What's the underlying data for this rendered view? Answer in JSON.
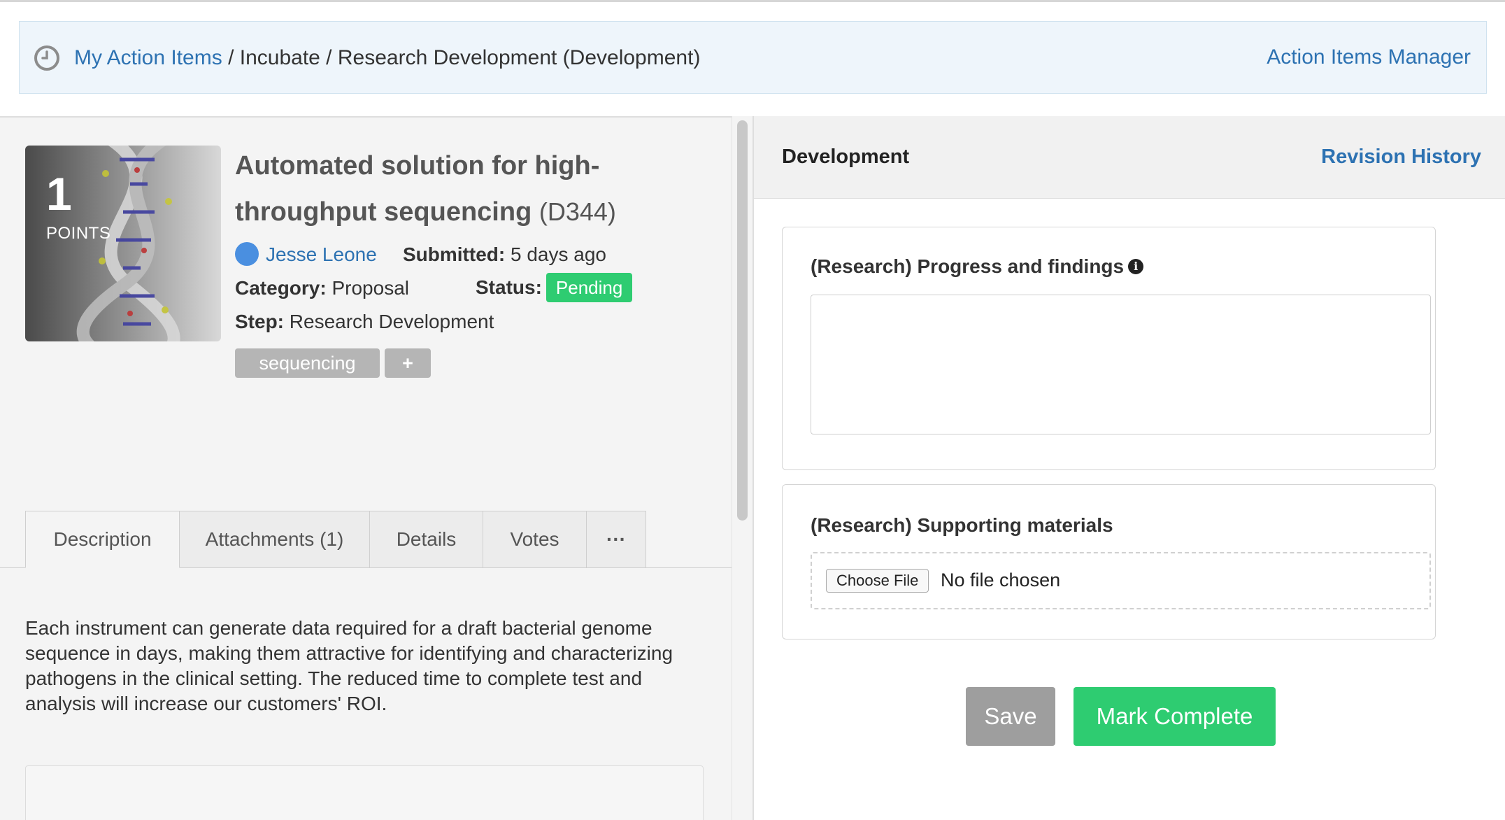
{
  "breadcrumb": {
    "root": "My Action Items",
    "separator": " / ",
    "stage": "Incubate",
    "current": "Research Development (Development)",
    "manager_link": "Action Items Manager"
  },
  "idea": {
    "points_value": "1",
    "points_label": "POINTS",
    "title": "Automated solution for high-throughput sequencing",
    "code": "(D344)",
    "author": "Jesse Leone",
    "submitted_label": "Submitted:",
    "submitted_value": "5 days ago",
    "category_label": "Category:",
    "category_value": "Proposal",
    "status_label": "Status:",
    "status_value": "Pending",
    "step_label": "Step:",
    "step_value": "Research Development",
    "tags": [
      "sequencing"
    ],
    "add_tag": "+"
  },
  "tabs": [
    {
      "label": "Description"
    },
    {
      "label": "Attachments (1)"
    },
    {
      "label": "Details"
    },
    {
      "label": "Votes"
    },
    {
      "label": "···"
    }
  ],
  "description": "Each instrument can generate data required for a draft bacterial genome sequence in days, making them attractive for identifying and characterizing pathogens in the clinical setting.  The reduced time to complete test and analysis will increase our customers' ROI.",
  "panel": {
    "title": "Development",
    "revision_link": "Revision History",
    "progress_label": "(Research) Progress and findings",
    "materials_label": "(Research) Supporting materials",
    "choose_file": "Choose File",
    "no_file": "No file chosen",
    "save": "Save",
    "mark_complete": "Mark Complete"
  },
  "colors": {
    "link": "#2d72b2",
    "success": "#2ecc71",
    "muted_button": "#9e9e9e"
  }
}
